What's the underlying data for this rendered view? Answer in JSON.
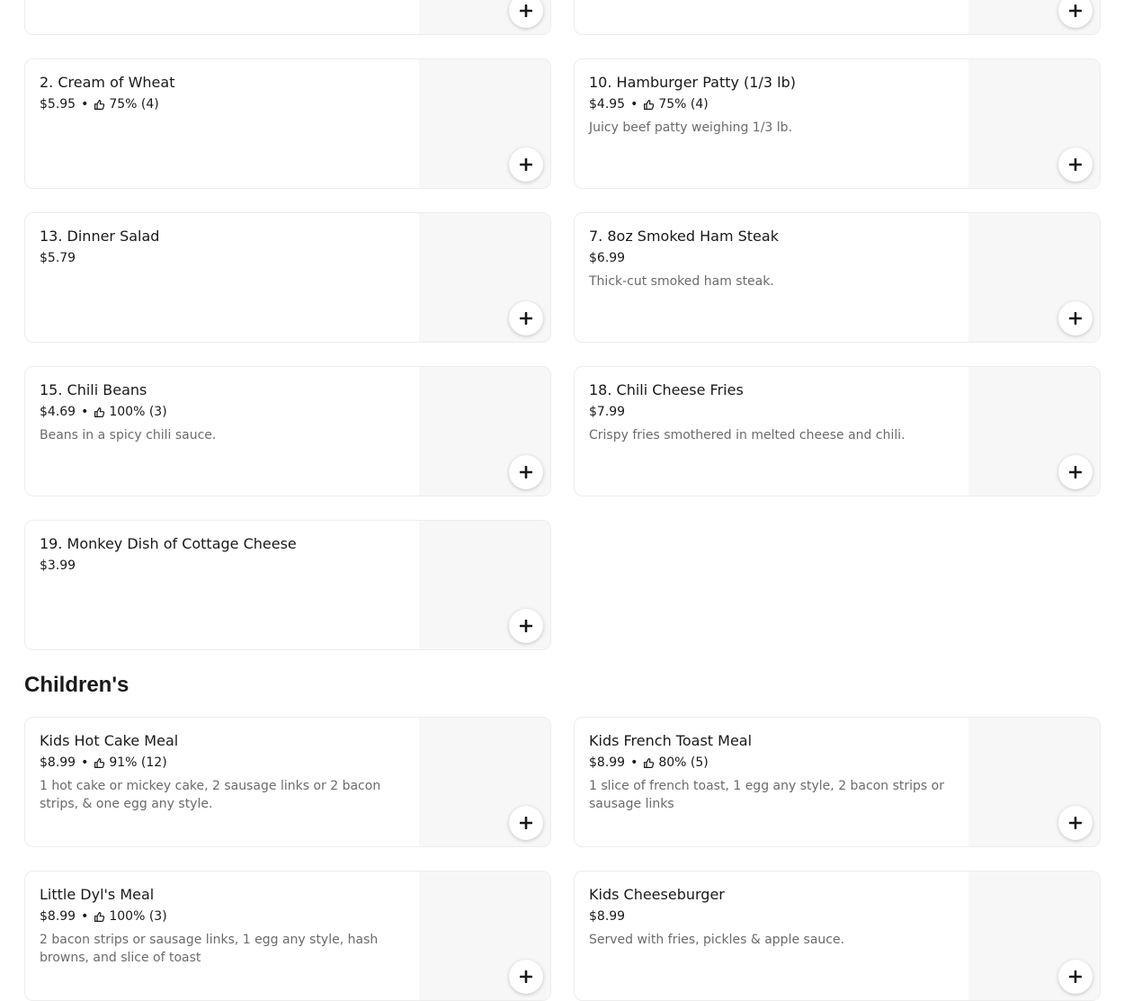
{
  "sections": {
    "children_title": "Children's"
  },
  "items": {
    "cream_of_wheat": {
      "name": "2. Cream of Wheat",
      "price": "$5.95",
      "rating": "75% (4)",
      "description": ""
    },
    "hamburger_patty": {
      "name": "10. Hamburger Patty (1/3 lb)",
      "price": "$4.95",
      "rating": "75% (4)",
      "description": "Juicy beef patty weighing 1/3 lb."
    },
    "dinner_salad": {
      "name": "13. Dinner Salad",
      "price": "$5.79",
      "description": ""
    },
    "ham_steak": {
      "name": "7. 8oz Smoked Ham Steak",
      "price": "$6.99",
      "description": "Thick-cut smoked ham steak."
    },
    "chili_beans": {
      "name": "15. Chili Beans",
      "price": "$4.69",
      "rating": "100% (3)",
      "description": "Beans in a spicy chili sauce."
    },
    "chili_cheese_fries": {
      "name": "18. Chili Cheese Fries",
      "price": "$7.99",
      "description": "Crispy fries smothered in melted cheese and chili."
    },
    "monkey_dish": {
      "name": "19. Monkey Dish of Cottage Cheese",
      "price": "$3.99",
      "description": ""
    },
    "kids_hot_cake": {
      "name": "Kids Hot Cake Meal",
      "price": "$8.99",
      "rating": "91% (12)",
      "description": "1 hot cake or mickey cake, 2 sausage links or 2 bacon strips, & one egg any style."
    },
    "kids_french_toast": {
      "name": "Kids French Toast Meal",
      "price": "$8.99",
      "rating": "80% (5)",
      "description": "1 slice of french toast, 1 egg any style, 2 bacon strips or sausage links"
    },
    "little_dyl": {
      "name": "Little Dyl's Meal",
      "price": "$8.99",
      "rating": "100% (3)",
      "description": "2 bacon strips or sausage links, 1 egg any style, hash browns, and slice of toast"
    },
    "kids_cheeseburger": {
      "name": "Kids Cheeseburger",
      "price": "$8.99",
      "description": "Served with fries, pickles & apple sauce."
    }
  },
  "icons": {
    "add": "plus-icon",
    "rating": "thumbs-up-icon"
  },
  "colors": {
    "text": "#191919",
    "muted": "#6b6b6b",
    "image_placeholder": "#f7f7f7",
    "card_border": "#ececec"
  }
}
